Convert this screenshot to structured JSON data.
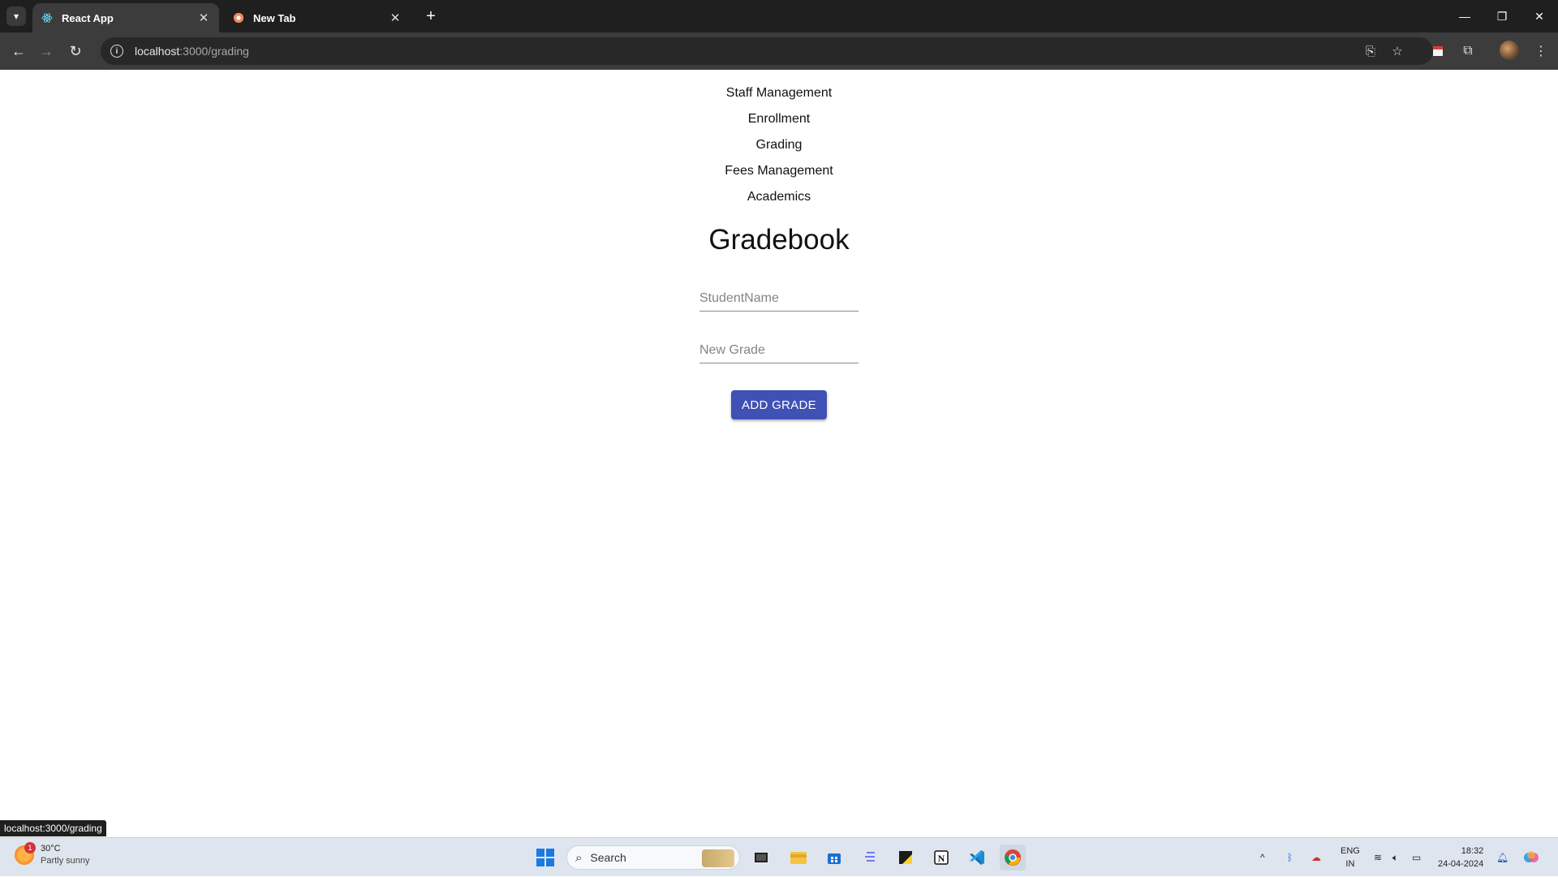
{
  "browser": {
    "tabs": [
      {
        "title": "React App",
        "favicon": "react-icon",
        "active": true
      },
      {
        "title": "New Tab",
        "favicon": "newtab-icon",
        "active": false
      }
    ],
    "new_tab_symbol": "+",
    "url_host": "localhost",
    "url_path": ":3000/grading",
    "status_link": "localhost:3000/grading"
  },
  "nav": {
    "links": [
      "Staff Management",
      "Enrollment",
      "Grading",
      "Fees Management",
      "Academics"
    ]
  },
  "gradebook": {
    "title": "Gradebook",
    "student_placeholder": "StudentName",
    "grade_placeholder": "New Grade",
    "add_button": "ADD GRADE"
  },
  "taskbar": {
    "weather_temp": "30°C",
    "weather_condition": "Partly sunny",
    "weather_badge": "1",
    "search_placeholder": "Search",
    "lang_line1": "ENG",
    "lang_line2": "IN",
    "time": "18:32",
    "date": "24-04-2024"
  },
  "colors": {
    "accent": "#3f51b5",
    "browser_dark": "#1f1f1f",
    "taskbar": "#dfe5ee"
  }
}
